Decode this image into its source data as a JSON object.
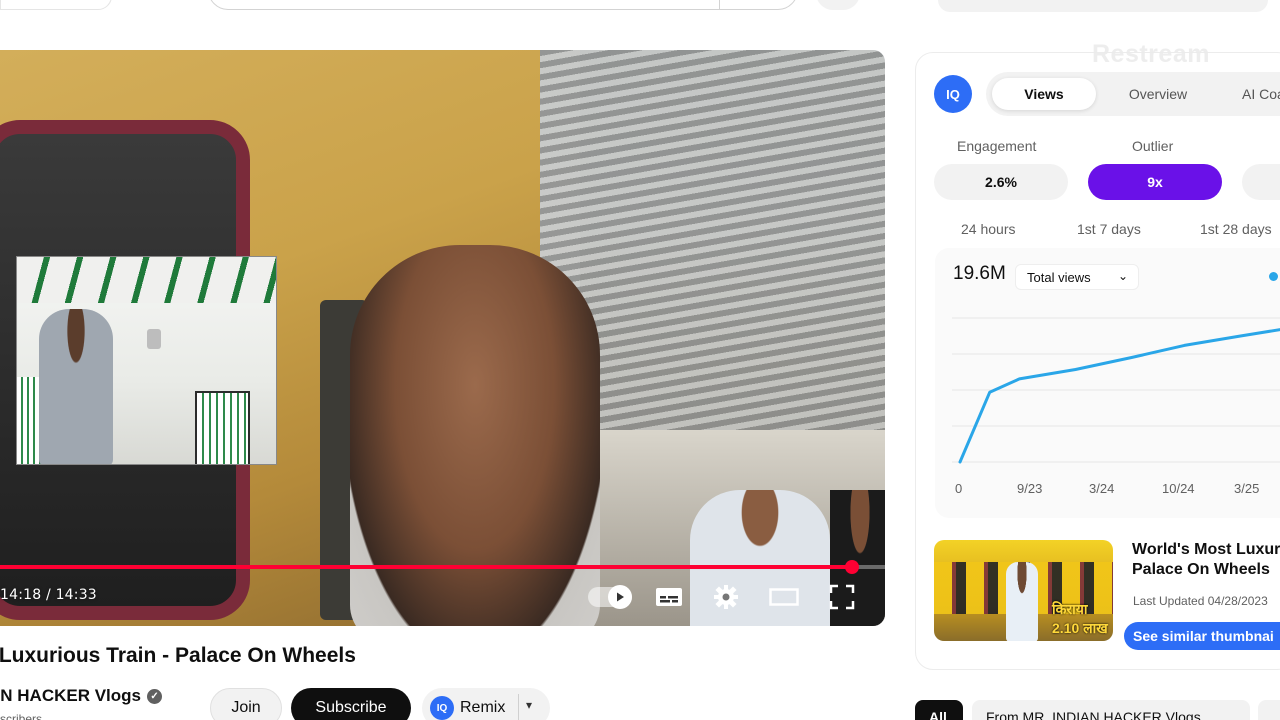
{
  "player": {
    "current_time": "14:18",
    "duration": "14:33",
    "time_display": "14:18 / 14:33",
    "progress_fraction": 0.963
  },
  "video": {
    "title": "t Luxurious Train - Palace On Wheels",
    "channel_name": "AN HACKER Vlogs",
    "subscribers": "scribers",
    "join_label": "Join",
    "subscribe_label": "Subscribe",
    "remix_label": "Remix"
  },
  "panel": {
    "watermark": "Restream",
    "logo_text": "IQ",
    "tabs": [
      {
        "label": "Views",
        "active": true
      },
      {
        "label": "Overview",
        "active": false
      },
      {
        "label": "AI Coa",
        "active": false
      }
    ],
    "metrics": [
      {
        "label": "Engagement",
        "value": "2.6%",
        "highlight": false
      },
      {
        "label": "Outlier",
        "value": "9x",
        "highlight": true
      }
    ],
    "ranges": [
      "24 hours",
      "1st 7 days",
      "1st 28 days"
    ],
    "total_views": "19.6M",
    "views_select": "Total views"
  },
  "chart_data": {
    "type": "line",
    "x": [
      "0",
      "9/23",
      "3/24",
      "10/24",
      "3/25"
    ],
    "series": [
      {
        "values": [
          0.0,
          0.52,
          0.62,
          0.69,
          0.78,
          0.87,
          0.94,
          1.0
        ]
      }
    ],
    "x_positions_label_indices": [
      0,
      1,
      2,
      3,
      4
    ],
    "grid": true,
    "color": "#2aa6e8"
  },
  "related": {
    "title_line1": "World's Most Luxur",
    "title_line2": "Palace On Wheels",
    "updated": "Last Updated 04/28/2023",
    "thumb_text": "किराया 2.10 लाख",
    "similar_button": "See similar thumbnai"
  },
  "chips": {
    "all": "All",
    "from": "From MR. INDIAN HACKER Vlogs"
  },
  "colors": {
    "progress": "#ff0033",
    "accent_blue": "#2d6df6",
    "outlier_purple": "#6a11e8",
    "chart_line": "#2aa6e8"
  }
}
